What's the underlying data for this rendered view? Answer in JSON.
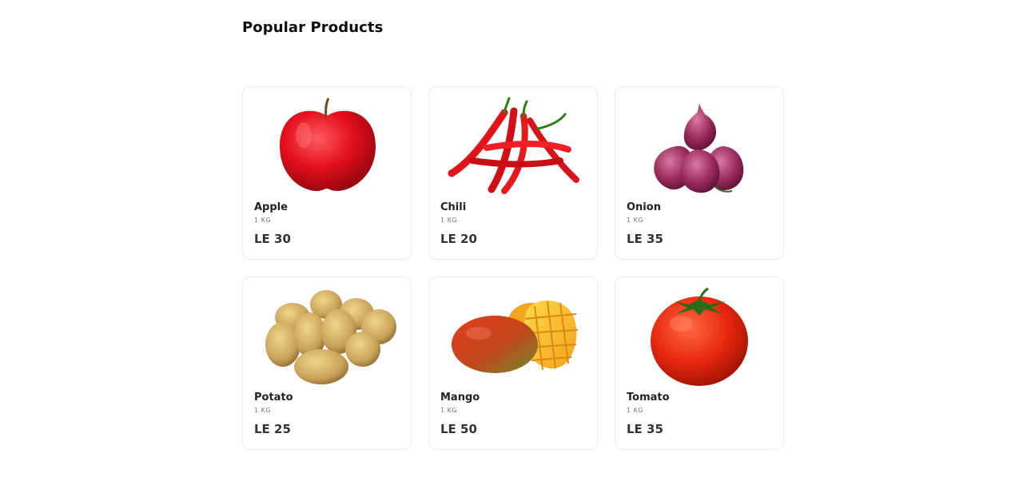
{
  "section": {
    "title": "Popular Products"
  },
  "products": [
    {
      "name": "Apple",
      "unit": "1 KG",
      "price": "LE 30",
      "image_icon": "apple-image"
    },
    {
      "name": "Chili",
      "unit": "1 KG",
      "price": "LE 20",
      "image_icon": "chili-image"
    },
    {
      "name": "Onion",
      "unit": "1 KG",
      "price": "LE 35",
      "image_icon": "onion-image"
    },
    {
      "name": "Potato",
      "unit": "1 KG",
      "price": "LE 25",
      "image_icon": "potato-image"
    },
    {
      "name": "Mango",
      "unit": "1 KG",
      "price": "LE 50",
      "image_icon": "mango-image"
    },
    {
      "name": "Tomato",
      "unit": "1 KG",
      "price": "LE 35",
      "image_icon": "tomato-image"
    }
  ],
  "colors": {
    "card_border": "#ececec",
    "text_primary": "#222222",
    "text_muted": "#777777"
  }
}
